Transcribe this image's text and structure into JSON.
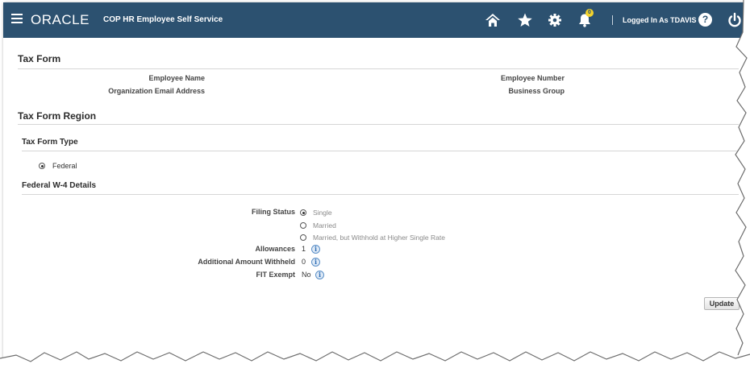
{
  "header": {
    "logo_text": "ORACLE",
    "app_title": "COP HR Employee Self Service",
    "notification_count": "0",
    "logged_in_text": "Logged In As TDAVIS",
    "help_glyph": "?",
    "icons": [
      "menu-icon",
      "home-icon",
      "favorites-star-icon",
      "settings-gear-icon",
      "notifications-bell-icon",
      "help-icon",
      "logout-power-icon"
    ],
    "bar_color": "#2c5170"
  },
  "page": {
    "title": "Tax Form",
    "fields": {
      "employee_name_label": "Employee Name",
      "org_email_label": "Organization Email Address",
      "employee_number_label": "Employee Number",
      "business_group_label": "Business Group"
    }
  },
  "region": {
    "title": "Tax Form Region",
    "tax_form_type_title": "Tax Form Type",
    "tax_form_type_option": "Federal",
    "w4_title": "Federal W-4 Details",
    "filing_status_label": "Filing Status",
    "filing_status_options": [
      "Single",
      "Married",
      "Married, but Withhold at Higher Single Rate"
    ],
    "filing_status_selected": "Single",
    "allowances_label": "Allowances",
    "allowances_value": "1",
    "additional_label": "Additional Amount Withheld",
    "additional_value": "0",
    "fit_exempt_label": "FIT Exempt",
    "fit_exempt_value": "No",
    "info_glyph": "i"
  },
  "actions": {
    "update_label": "Update"
  }
}
